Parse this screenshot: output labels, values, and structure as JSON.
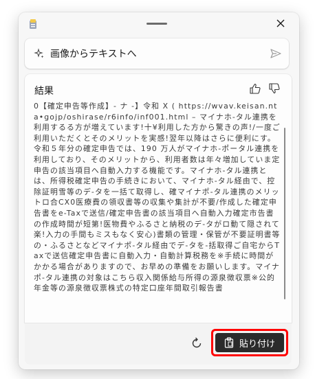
{
  "prompt": {
    "text": "画像からテキストへ"
  },
  "result": {
    "title": "結果",
    "body": "0【確定申告等作成】- ナ -】令和 X ( https://wvav.keisan.nta•gojp/oshirase/r6info/inf001.html – マイナホ-タル連携を利用するる方が増えています!十¥利用した方から驚きの声!/一度ご利用いただくとそのメリットを実感!翌年以降はさらに便利にす。令和５年分の確定申告では、190 万人がマイナホ-ポータル連携を利用しており、そのメリットから、利用者数は年々増加していま定申告の該当項目へ自動入力する機能です。マイナホ-タル連携とは、所得税確定申告の手続きにおいて、マイナホ-タル経由で、控除証明雪等のデ-タを一括て取得し、確マイナポ-タル連携のメリットロ合CX0医療費の領収書等の収集や集計が不要/作成した確定申告書をe-Taxで送信/確定申告書の該当項目へ自動入力確定市告書の作成時間が短第!医物費やふるさと納税のデ-タがロ動て隠されて楽!入力の手間もミスもなく安心)書類の管理・保管が不要証明書等の・ふるさとなどマイナポ-タル経由でデ-タを-括取得ご自宅からTaxで送信確定申告書に自動入力・自動計算税務を※手続に時間がかかる場合がありますので、お早めの準備をお願いします。マイナポ-タル連携の対象はこちら収入関係給与所得の源泉徴収票※公的年金等の源泉徴収票株式の特定口座年間取引報告書"
  },
  "actions": {
    "paste_label": "貼り付け"
  },
  "colors": {
    "highlight": "#ff0000",
    "button_bg": "#2b2b2b"
  },
  "icons": [
    "app-icon",
    "close-icon",
    "sparkle-icon",
    "send-icon",
    "thumbs-up-icon",
    "thumbs-down-icon",
    "refresh-icon",
    "paste-icon"
  ]
}
